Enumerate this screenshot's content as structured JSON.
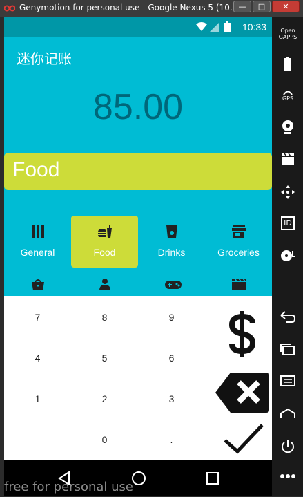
{
  "window": {
    "title": "Genymotion for personal use - Google Nexus 5 (10...",
    "minimize": "—",
    "maximize": "□",
    "close": "✕"
  },
  "statusbar": {
    "time": "10:33"
  },
  "app": {
    "title": "迷你记账",
    "amount": "85.00",
    "selected_category": "Food"
  },
  "categories": [
    {
      "label": "General",
      "icon": "bars-icon"
    },
    {
      "label": "Food",
      "icon": "food-icon"
    },
    {
      "label": "Drinks",
      "icon": "drink-icon"
    },
    {
      "label": "Groceries",
      "icon": "store-icon"
    }
  ],
  "categories_row2_icons": [
    "shopping-bag-icon",
    "person-icon",
    "gamepad-icon",
    "clapperboard-icon"
  ],
  "keypad": {
    "keys": [
      "7",
      "8",
      "9",
      "4",
      "5",
      "6",
      "1",
      "2",
      "3",
      "0",
      "."
    ],
    "actions": [
      "dollar-icon",
      "backspace-icon",
      "check-icon"
    ]
  },
  "sidebar": {
    "items": [
      {
        "label": "Open GAPPS",
        "icon": "gapps-icon"
      },
      {
        "label": "",
        "icon": "battery-icon"
      },
      {
        "label": "GPS",
        "icon": "gps-icon"
      },
      {
        "label": "",
        "icon": "webcam-icon"
      },
      {
        "label": "",
        "icon": "clapperboard-icon"
      },
      {
        "label": "",
        "icon": "dpad-icon"
      },
      {
        "label": "ID",
        "icon": "id-icon"
      },
      {
        "label": "",
        "icon": "media-icon"
      },
      {
        "label": "",
        "icon": "back-icon"
      },
      {
        "label": "",
        "icon": "recent-apps-icon"
      },
      {
        "label": "",
        "icon": "menu-icon"
      },
      {
        "label": "",
        "icon": "home-icon"
      },
      {
        "label": "",
        "icon": "power-icon"
      },
      {
        "label": "",
        "icon": "more-icon"
      }
    ]
  },
  "watermark": "free for personal use",
  "colors": {
    "primary": "#00bcd4",
    "status": "#0097a7",
    "accent": "#cddc39",
    "amount": "#00677a"
  }
}
